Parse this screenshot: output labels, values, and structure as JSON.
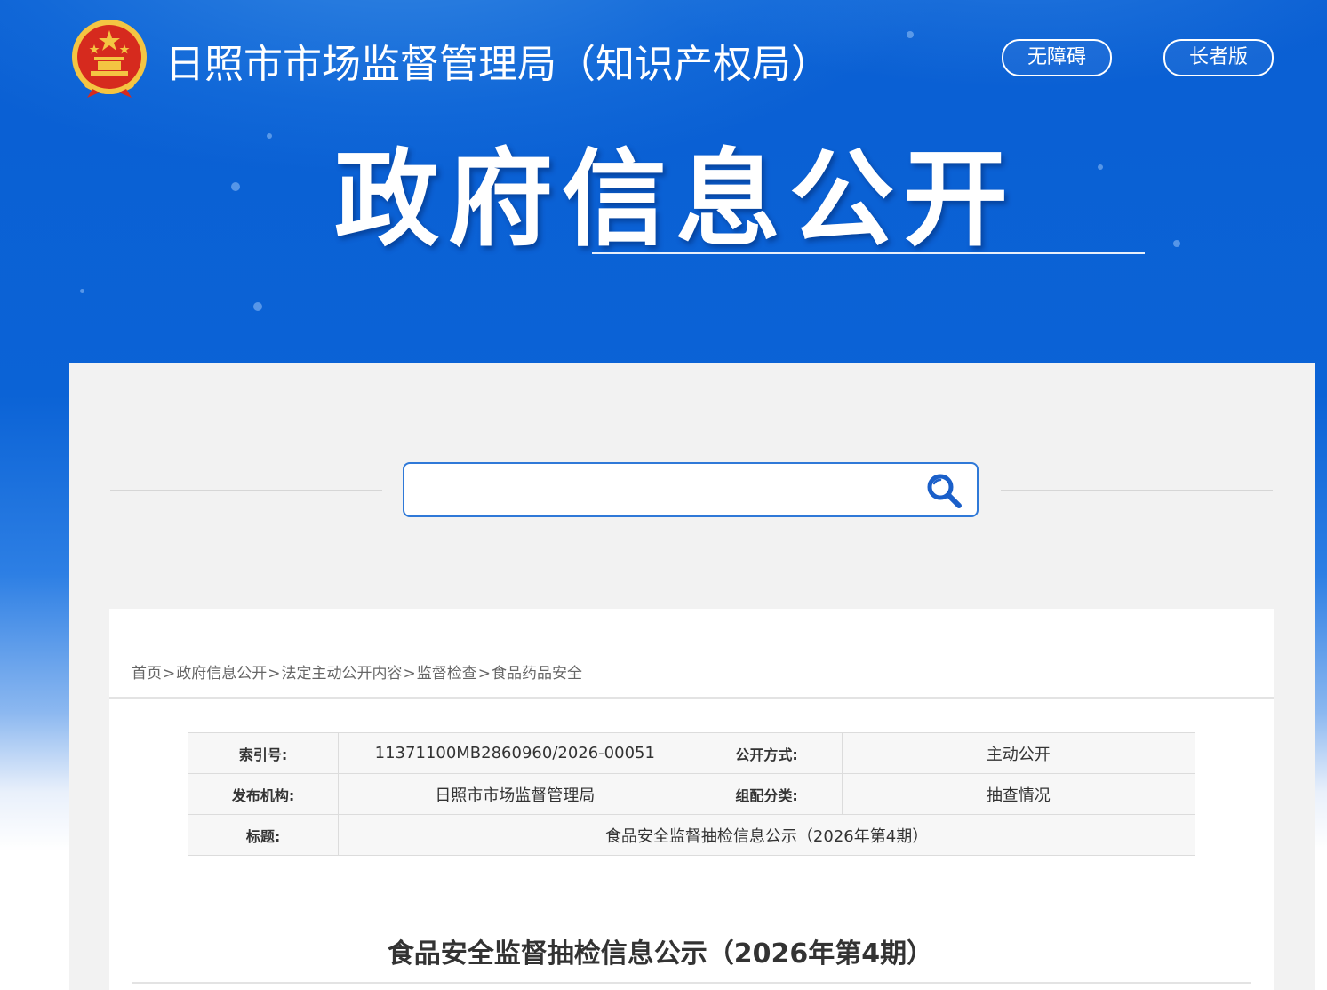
{
  "header": {
    "site_name": "日照市市场监督管理局（知识产权局）",
    "accessibility_label": "无障碍",
    "elderly_label": "长者版",
    "banner_title": "政府信息公开"
  },
  "search": {
    "placeholder": "",
    "value": ""
  },
  "breadcrumb": {
    "items": [
      "首页",
      "政府信息公开",
      "法定主动公开内容",
      "监督检查",
      "食品药品安全"
    ],
    "separator": ">"
  },
  "meta_table": {
    "index_label": "索引号:",
    "index_value": "11371100MB2860960/2026-00051",
    "disclosure_label": "公开方式:",
    "disclosure_value": "主动公开",
    "publisher_label": "发布机构:",
    "publisher_value": "日照市市场监督管理局",
    "category_label": "组配分类:",
    "category_value": "抽查情况",
    "title_label": "标题:",
    "title_value": "食品安全监督抽检信息公示（2026年第4期）"
  },
  "article": {
    "title": "食品安全监督抽检信息公示（2026年第4期）"
  },
  "colors": {
    "header_blue": "#0a5fd3",
    "search_border": "#2f79d8",
    "emblem_red": "#d62a1e",
    "emblem_gold": "#f4c542"
  }
}
